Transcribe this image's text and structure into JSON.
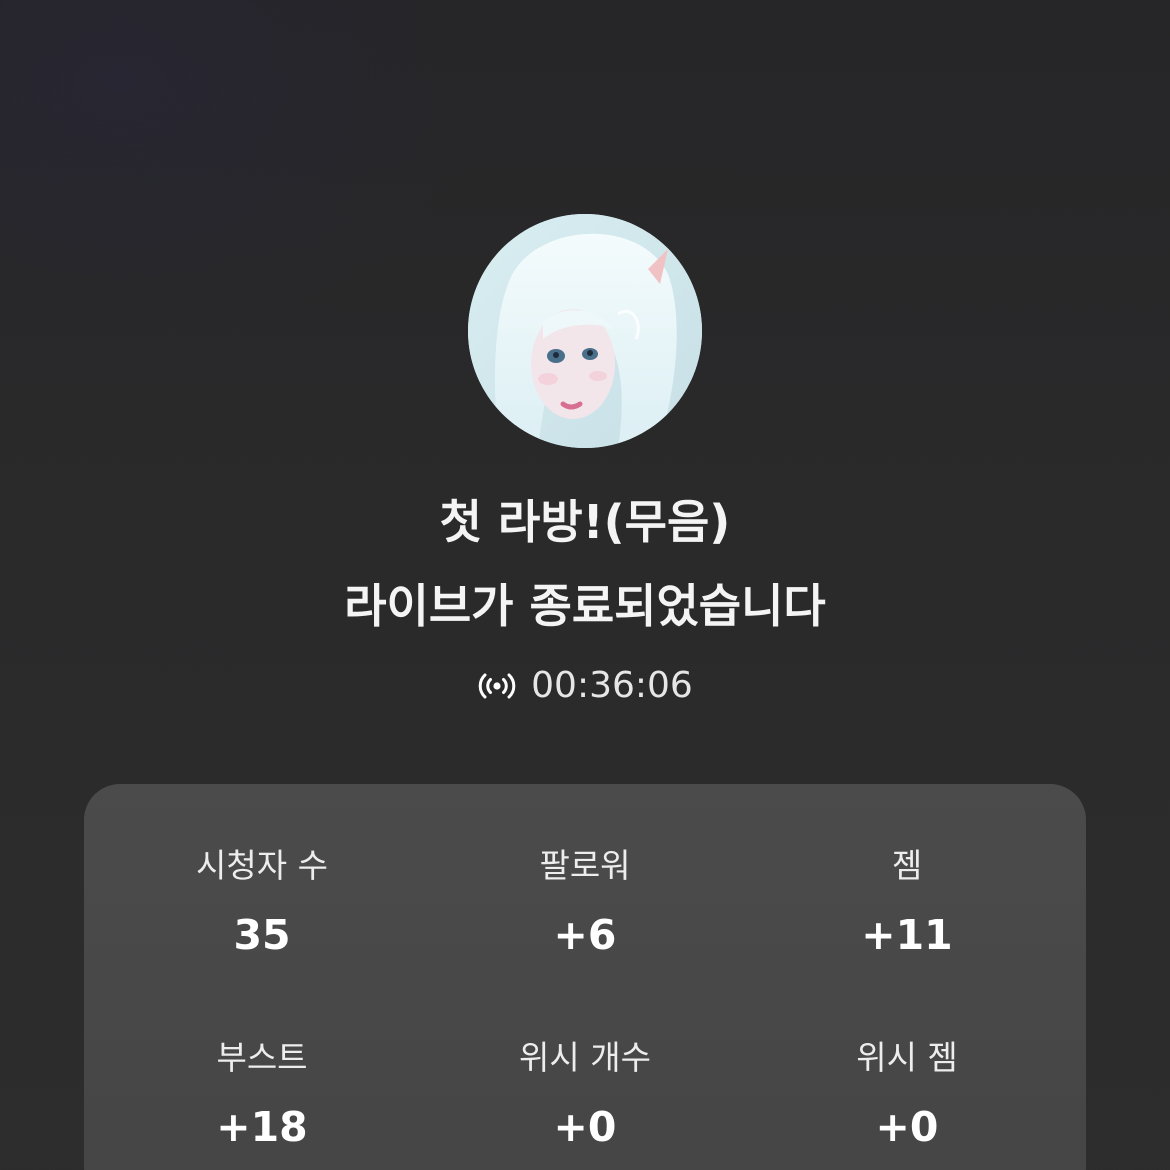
{
  "stream": {
    "title": "첫 라방!(무음)",
    "ended_message": "라이브가 종료되었습니다",
    "duration": "00:36:06",
    "live_icon": "broadcast-icon"
  },
  "stats": [
    {
      "label": "시청자 수",
      "value": "35"
    },
    {
      "label": "팔로워",
      "value": "+6"
    },
    {
      "label": "젬",
      "value": "+11"
    },
    {
      "label": "부스트",
      "value": "+18"
    },
    {
      "label": "위시 개수",
      "value": "+0"
    },
    {
      "label": "위시 젬",
      "value": "+0"
    }
  ],
  "colors": {
    "background": "#2a2a2b",
    "card": "#494949",
    "text": "#ffffff"
  }
}
